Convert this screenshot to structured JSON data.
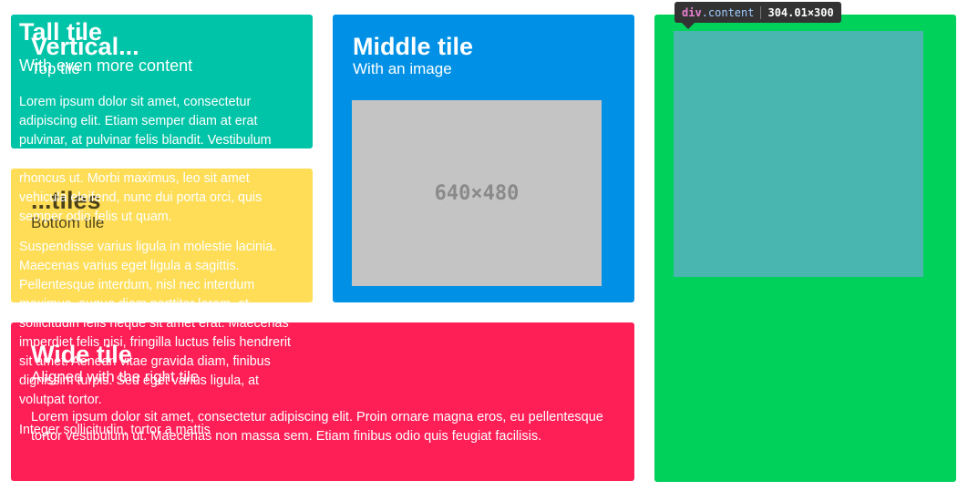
{
  "tiles": {
    "top": {
      "title": "Vertical...",
      "subtitle": "Top tile"
    },
    "bottom": {
      "title": "...tiles",
      "subtitle": "Bottom tile"
    },
    "middle": {
      "title": "Middle tile",
      "subtitle": "With an image",
      "image_label": "640×480"
    },
    "wide": {
      "title": "Wide tile",
      "subtitle": "Aligned with the right tile",
      "body": "Lorem ipsum dolor sit amet, consectetur adipiscing elit. Proin ornare magna eros, eu pellentesque tortor vestibulum ut. Maecenas non massa sem. Etiam finibus odio quis feugiat facilisis."
    },
    "tall": {
      "title": "Tall tile",
      "subtitle": "With even more content",
      "paragraphs": [
        "Lorem ipsum dolor sit amet, consectetur adipiscing elit. Etiam semper diam at erat pulvinar, at pulvinar felis blandit. Vestibulum volutpat tellus diam, consequat gravida libero rhoncus ut. Morbi maximus, leo sit amet vehicula eleifend, nunc dui porta orci, quis semper odio felis ut quam.",
        "Suspendisse varius ligula in molestie lacinia. Maecenas varius eget ligula a sagittis. Pellentesque interdum, nisl nec interdum maximus, augue diam porttitor lorem, et sollicitudin felis neque sit amet erat. Maecenas imperdiet felis nisi, fringilla luctus felis hendrerit sit amet. Aenean vitae gravida diam, finibus dignissim turpis. Sed eget varius ligula, at volutpat tortor.",
        "Integer sollicitudin, tortor a mattis"
      ]
    }
  },
  "devtools": {
    "tag": "div",
    "class": ".content",
    "dimensions": "304.01×300"
  },
  "colors": {
    "turquoise": "#00c4a7",
    "yellow": "#ffdd57",
    "blue": "#0091e6",
    "red": "#ff1f57",
    "green": "#00d15a"
  }
}
